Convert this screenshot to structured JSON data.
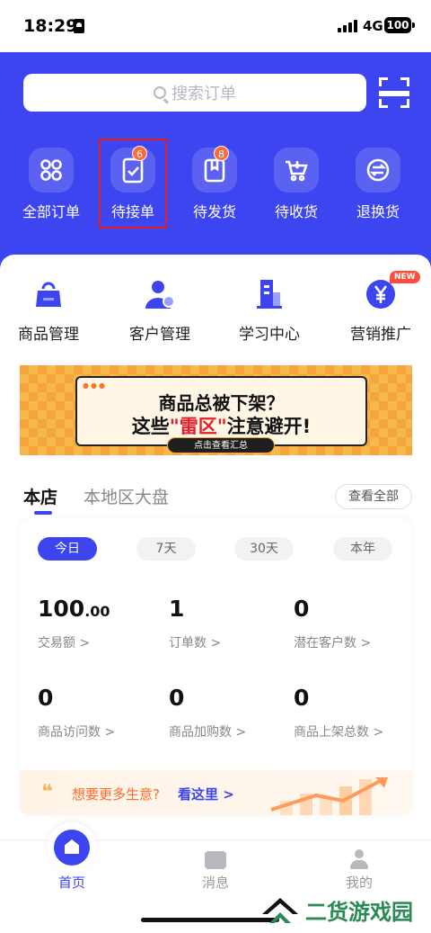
{
  "status_bar": {
    "time": "18:29",
    "network": "4G",
    "battery": "100"
  },
  "search": {
    "placeholder": "搜索订单"
  },
  "orders": [
    {
      "label": "全部订单",
      "icon": "grid-icon"
    },
    {
      "label": "待接单",
      "icon": "clipboard-check-icon",
      "badge": "6"
    },
    {
      "label": "待发货",
      "icon": "package-icon",
      "badge": "8"
    },
    {
      "label": "待收货",
      "icon": "cart-icon"
    },
    {
      "label": "退换货",
      "icon": "exchange-icon"
    }
  ],
  "tools": [
    {
      "label": "商品管理",
      "icon": "bag-icon"
    },
    {
      "label": "客户管理",
      "icon": "user-gear-icon"
    },
    {
      "label": "学习中心",
      "icon": "building-icon"
    },
    {
      "label": "营销推广",
      "icon": "yen-coin-icon",
      "tag": "NEW"
    }
  ],
  "banner": {
    "line1": "商品总被下架？",
    "line2_prefix": "这些",
    "line2_highlight": "\"雷区\"",
    "line2_suffix": "注意避开!",
    "button": "点击查看汇总"
  },
  "data_tabs": {
    "active": "本店",
    "inactive": "本地区大盘",
    "view_all": "查看全部"
  },
  "ranges": [
    "今日",
    "7天",
    "30天",
    "本年"
  ],
  "stats": [
    {
      "value": "100",
      "decimal": ".00",
      "label": "交易额 >"
    },
    {
      "value": "1",
      "label": "订单数 >"
    },
    {
      "value": "0",
      "label": "潜在客户数 >"
    },
    {
      "value": "0",
      "label": "商品访问数 >"
    },
    {
      "value": "0",
      "label": "商品加购数 >"
    },
    {
      "value": "0",
      "label": "商品上架总数 >"
    }
  ],
  "promo": {
    "text": "想要更多生意?",
    "link": "看这里 >"
  },
  "tabbar": [
    {
      "label": "首页",
      "icon": "home-icon"
    },
    {
      "label": "消息",
      "icon": "message-icon"
    },
    {
      "label": "我的",
      "icon": "person-icon"
    }
  ],
  "watermark": {
    "text": "二货游戏园"
  },
  "colors": {
    "primary": "#3c45f0",
    "badge": "#ff6a3d",
    "highlight_box": "#e02020"
  }
}
